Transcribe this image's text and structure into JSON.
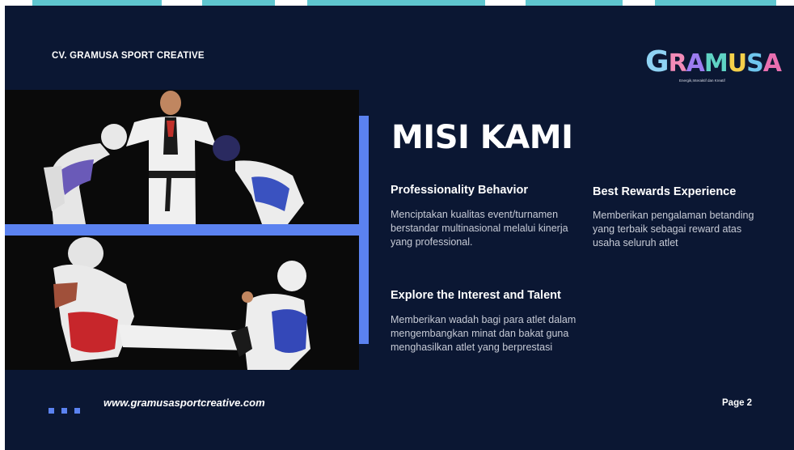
{
  "header": {
    "company": "CV. GRAMUSA SPORT CREATIVE",
    "logo_text": "GRAMUSA",
    "logo_tagline": "Energik, Interaktif dan Kreatif"
  },
  "main": {
    "title": "MISI KAMI",
    "missions": [
      {
        "heading": "Professionality Behavior",
        "body": "Menciptakan kualitas event/turnamen berstandar multinasional melalui kinerja yang professional."
      },
      {
        "heading": "Best Rewards Experience",
        "body": "Memberikan pengalaman betanding yang terbaik sebagai reward atas usaha seluruh atlet"
      },
      {
        "heading": "Explore the  Interest and Talent",
        "body": "Memberikan wadah bagi para atlet dalam mengembangkan minat dan bakat guna menghasilkan atlet yang berprestasi"
      }
    ]
  },
  "footer": {
    "url": "www.gramusasportcreative.com",
    "page": "Page 2"
  },
  "colors": {
    "background": "#0b1733",
    "accent_blue": "#5b82f0",
    "top_strip": "#5fc6cf"
  },
  "icons": [
    "gramusa-logo",
    "decorative-dots"
  ]
}
